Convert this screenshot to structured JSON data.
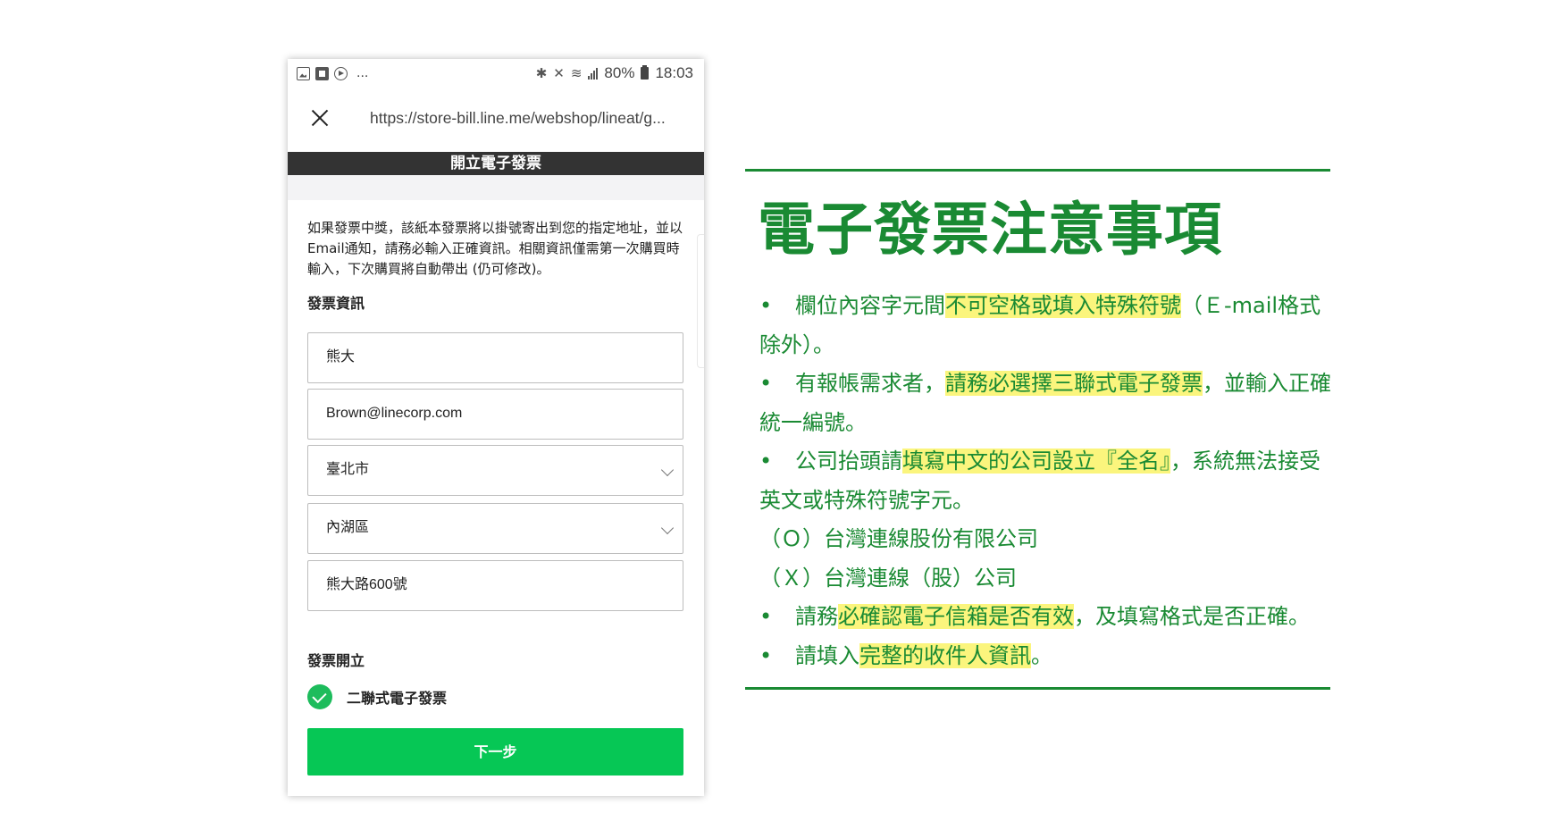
{
  "status_bar": {
    "left_icons": [
      "image-icon",
      "flipboard-icon",
      "play-icon"
    ],
    "more": "...",
    "battery": "80%",
    "time": "18:03"
  },
  "browser": {
    "url": "https://store-bill.line.me/webshop/lineat/g..."
  },
  "page": {
    "title": "開立電子發票",
    "notice": "如果發票中獎，該紙本發票將以掛號寄出到您的指定地址，並以Email通知，請務必輸入正確資訊。相關資訊僅需第一次購買時輸入，下次購買將自動帶出 (仍可修改)。",
    "invoice_info_title": "發票資訊",
    "fields": {
      "name": "熊大",
      "email": "Brown@linecorp.com",
      "city": "臺北市",
      "district": "內湖區",
      "address": "熊大路600號"
    },
    "invoice_issue_title": "發票開立",
    "invoice_type": "二聯式電子發票",
    "next_button": "下一步"
  },
  "notes": {
    "heading": "電子發票注意事項",
    "bullet": "•",
    "line1": {
      "a": "欄位內容字元間",
      "hl": "不可空格或填入特殊符號",
      "b": "（Ｅ-mail格式"
    },
    "line2": "除外）。",
    "line3": {
      "a": "有報帳需求者，",
      "hl": "請務必選擇三聯式電子發票",
      "b": "，並輸入正確"
    },
    "line4": "統一編號。",
    "line5": {
      "a": "公司抬頭請",
      "hl": "填寫中文的公司設立『全名』",
      "b": "，系統無法接受"
    },
    "line6": "英文或特殊符號字元。",
    "line7": "（Ｏ）台灣連線股份有限公司",
    "line8": "（Ｘ）台灣連線（股）公司",
    "line9": {
      "a": "請務",
      "hl": "必確認電子信箱是否有效",
      "b": "，及填寫格式是否正確。"
    },
    "line10": {
      "a": "請填入",
      "hl": "完整的收件人資訊",
      "b": "。"
    }
  },
  "colors": {
    "accent_green": "#1a8a33",
    "line_green": "#06c755",
    "highlight": "#fbf57d"
  }
}
